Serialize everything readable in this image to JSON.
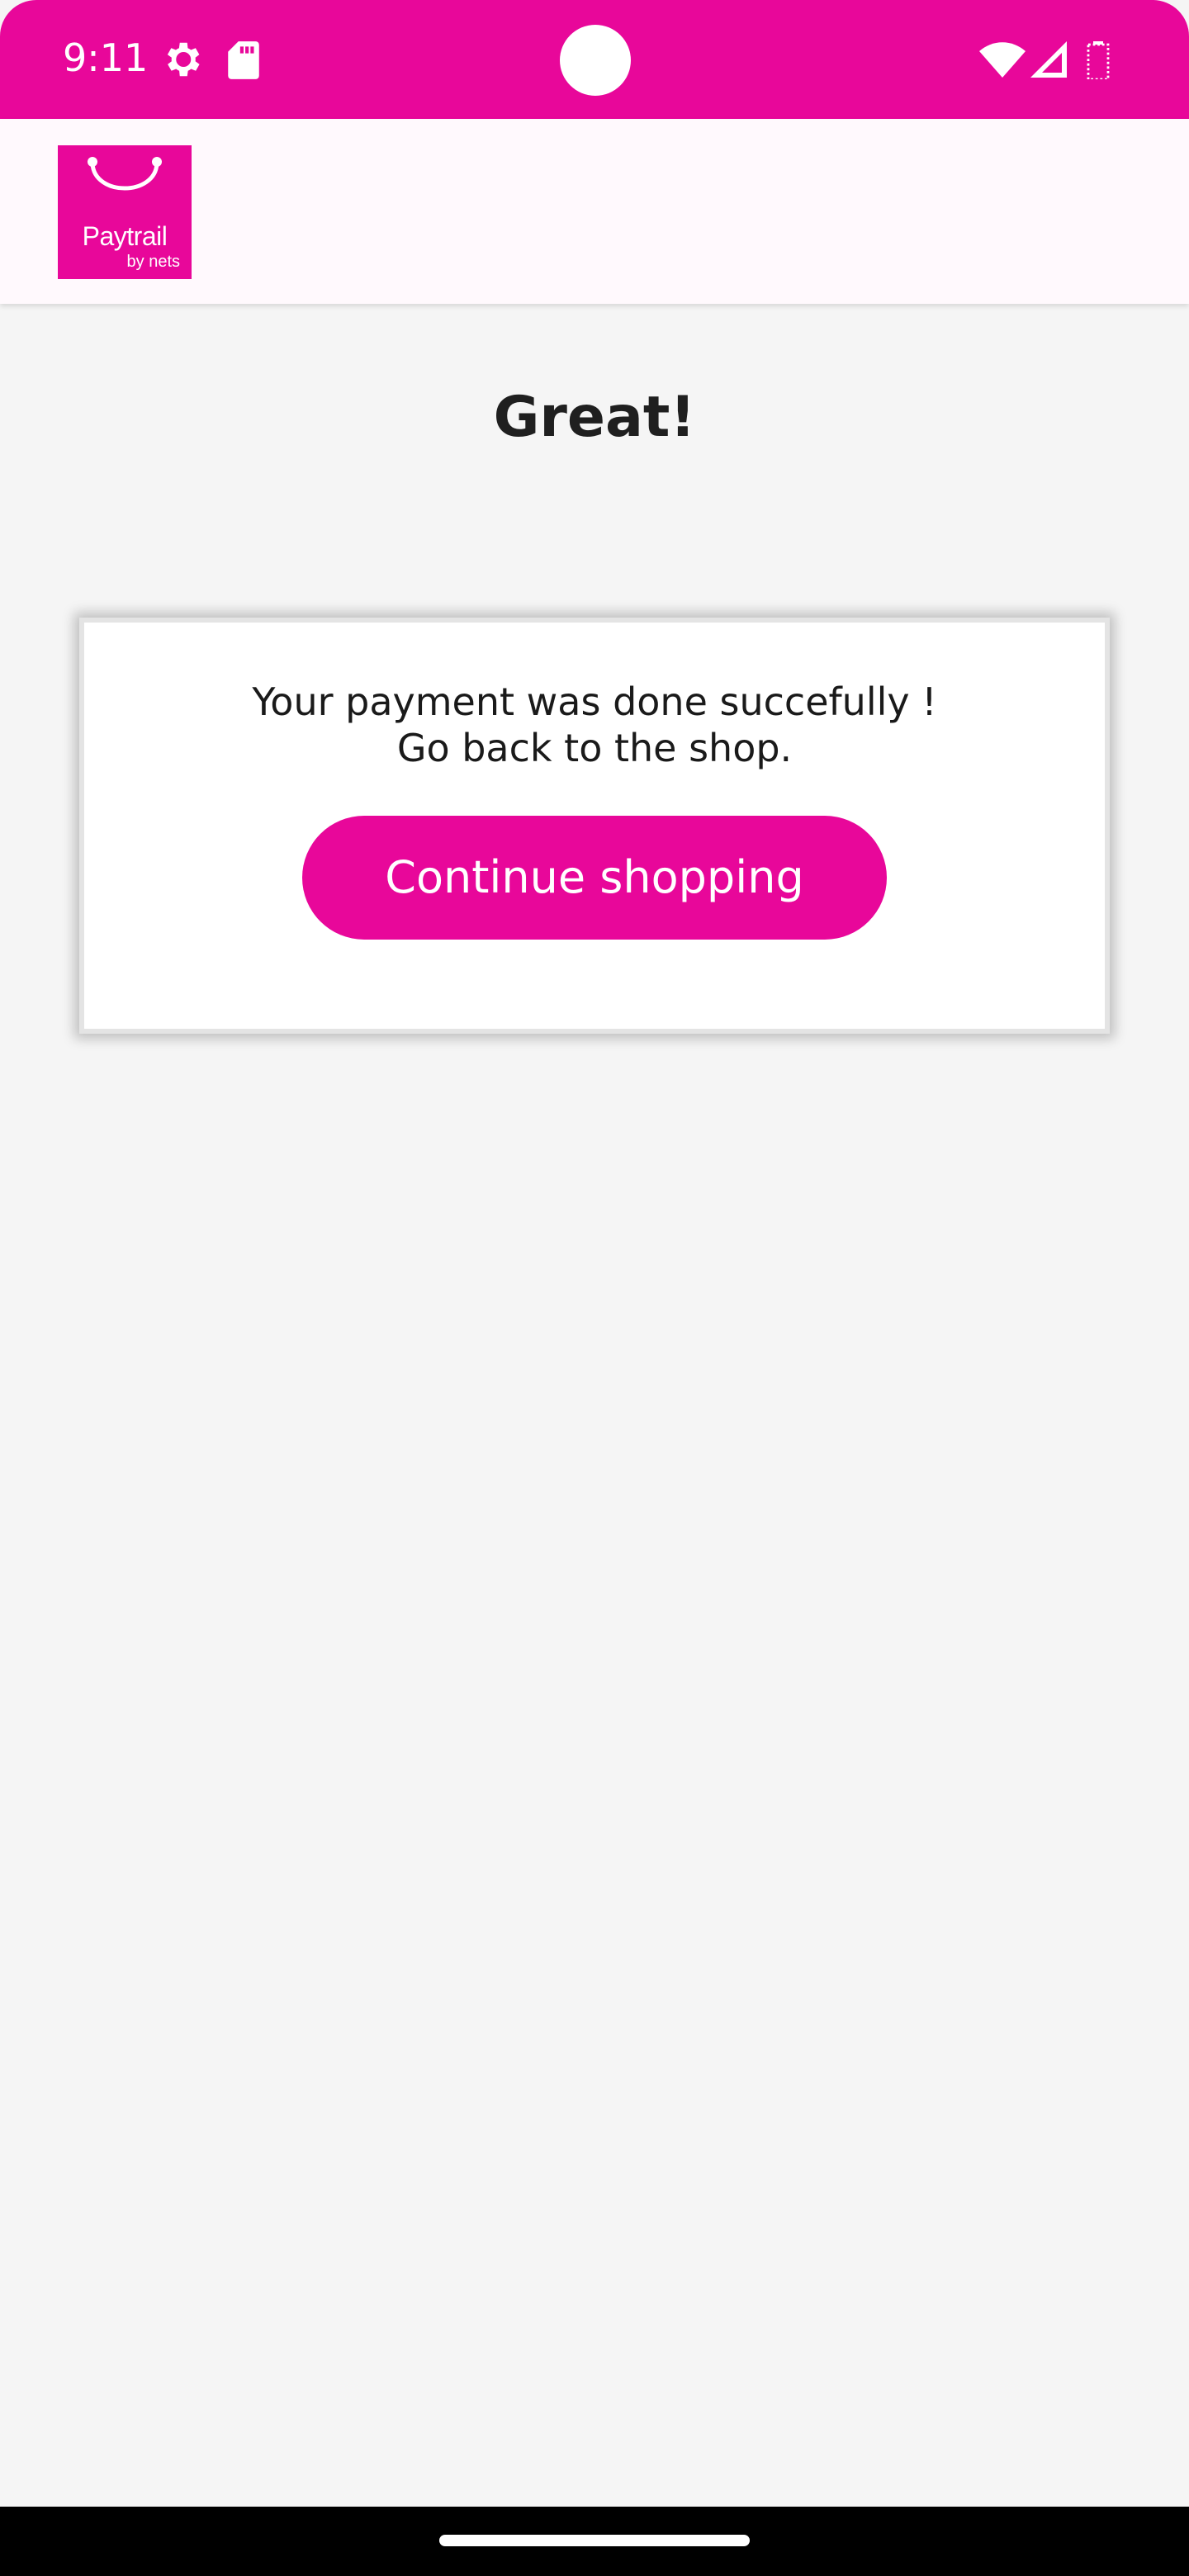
{
  "status_bar": {
    "time": "9:11",
    "icons": [
      "gear-icon",
      "sd-card-icon",
      "wifi-icon",
      "cellular-signal-icon",
      "battery-icon"
    ],
    "color": "#e8079a"
  },
  "header": {
    "logo_text": "Paytrail",
    "logo_subtext": "by nets",
    "logo_color": "#e8079a"
  },
  "main": {
    "title": "Great!",
    "message_line1": "Your payment was done succefully !",
    "message_line2": "Go back to the shop.",
    "continue_label": "Continue shopping",
    "accent_color": "#e8079a"
  }
}
